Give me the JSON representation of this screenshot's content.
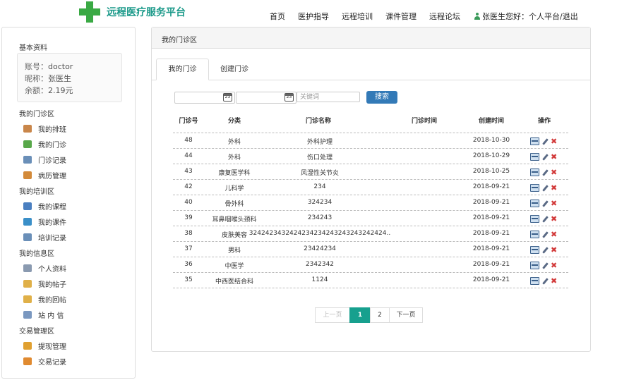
{
  "brand": {
    "title": "远程医疗服务平台",
    "accent": "#1c9a8a",
    "logo_color": "#3aa944"
  },
  "nav": {
    "items": [
      "首页",
      "医护指导",
      "远程培训",
      "课件管理",
      "远程论坛"
    ]
  },
  "user": {
    "greeting": "张医生您好：",
    "links": "个人平台/退出"
  },
  "sidebar": {
    "profile_title": "基本资料",
    "profile": [
      {
        "label": "账号：",
        "value": "doctor"
      },
      {
        "label": "昵称：",
        "value": "张医生"
      },
      {
        "label": "余额：",
        "value": "2.19元"
      }
    ],
    "sections": [
      {
        "title": "我的门诊区",
        "items": [
          {
            "label": "我的排班",
            "icon": "calendar-icon"
          },
          {
            "label": "我的门诊",
            "icon": "clinic-icon"
          },
          {
            "label": "门诊记录",
            "icon": "record-icon"
          },
          {
            "label": "病历管理",
            "icon": "medical-record-icon"
          }
        ]
      },
      {
        "title": "我的培训区",
        "items": [
          {
            "label": "我的课程",
            "icon": "book-icon"
          },
          {
            "label": "我的课件",
            "icon": "globe-icon"
          },
          {
            "label": "培训记录",
            "icon": "record-icon"
          }
        ]
      },
      {
        "title": "我的信息区",
        "items": [
          {
            "label": "个人资料",
            "icon": "profile-card-icon"
          },
          {
            "label": "我的帖子",
            "icon": "chat-icon"
          },
          {
            "label": "我的回帖",
            "icon": "reply-icon"
          },
          {
            "label": "站 内 信",
            "icon": "mail-icon"
          }
        ]
      },
      {
        "title": "交易管理区",
        "items": [
          {
            "label": "提现管理",
            "icon": "coins-icon"
          },
          {
            "label": "交易记录",
            "icon": "ledger-icon"
          }
        ]
      }
    ]
  },
  "main": {
    "title": "我的门诊区",
    "tabs": [
      "我的门诊",
      "创建门诊"
    ],
    "search": {
      "calendar_day": "23",
      "keyword_placeholder": "关键词",
      "button": "搜索"
    },
    "table": {
      "headers": [
        "门诊号",
        "分类",
        "门诊名称",
        "门诊时间",
        "创建时间",
        "操作"
      ],
      "rows": [
        {
          "id": "48",
          "category": "外科",
          "name": "外科护理",
          "time": "",
          "created": "2018-10-30"
        },
        {
          "id": "44",
          "category": "外科",
          "name": "伤口处理",
          "time": "",
          "created": "2018-10-29"
        },
        {
          "id": "43",
          "category": "康复医学科",
          "name": "风湿性关节炎",
          "time": "",
          "created": "2018-10-25"
        },
        {
          "id": "42",
          "category": "儿科学",
          "name": "234",
          "time": "",
          "created": "2018-09-21"
        },
        {
          "id": "40",
          "category": "骨外科",
          "name": "324234",
          "time": "",
          "created": "2018-09-21"
        },
        {
          "id": "39",
          "category": "耳鼻咽喉头颈科",
          "name": "234243",
          "time": "",
          "created": "2018-09-21"
        },
        {
          "id": "38",
          "category": "皮肤美容",
          "name": "3242423432424234234243243243242424..",
          "time": "",
          "created": "2018-09-21"
        },
        {
          "id": "37",
          "category": "男科",
          "name": "23424234",
          "time": "",
          "created": "2018-09-21"
        },
        {
          "id": "36",
          "category": "中医学",
          "name": "2342342",
          "time": "",
          "created": "2018-09-21"
        },
        {
          "id": "35",
          "category": "中西医结合科",
          "name": "1124",
          "time": "",
          "created": "2018-09-21"
        }
      ]
    },
    "pagination": {
      "prev": "上一页",
      "pages": [
        "1",
        "2"
      ],
      "current": "1",
      "next": "下一页",
      "active_color": "#17a08e"
    }
  }
}
